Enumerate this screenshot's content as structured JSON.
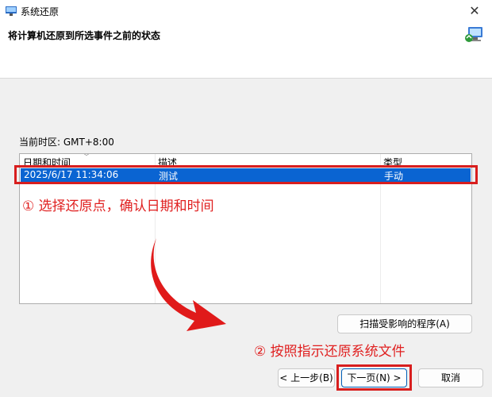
{
  "window": {
    "title": "系统还原",
    "close_glyph": "✕"
  },
  "header": {
    "title": "将计算机还原到所选事件之前的状态"
  },
  "timezone_label": "当前时区: GMT+8:00",
  "table": {
    "columns": [
      "日期和时间",
      "描述",
      "类型"
    ],
    "rows": [
      {
        "date": "2025/6/17 11:34:06",
        "description": "测试",
        "type": "手动",
        "selected": true
      }
    ]
  },
  "buttons": {
    "scan": "扫描受影响的程序(A)",
    "back": "< 上一步(B)",
    "next": "下一页(N) >",
    "cancel": "取消"
  },
  "annotations": {
    "step1": "① 选择还原点，确认日期和时间",
    "step2": "② 按照指示还原系统文件",
    "color": "#e02020"
  },
  "icons": [
    "system-restore-icon",
    "restore-computer-icon",
    "close-icon",
    "sort-arrow-icon"
  ],
  "colors": {
    "selection": "#0a64d2",
    "annotation": "#d81e1e",
    "primary_border": "#005fb8"
  }
}
